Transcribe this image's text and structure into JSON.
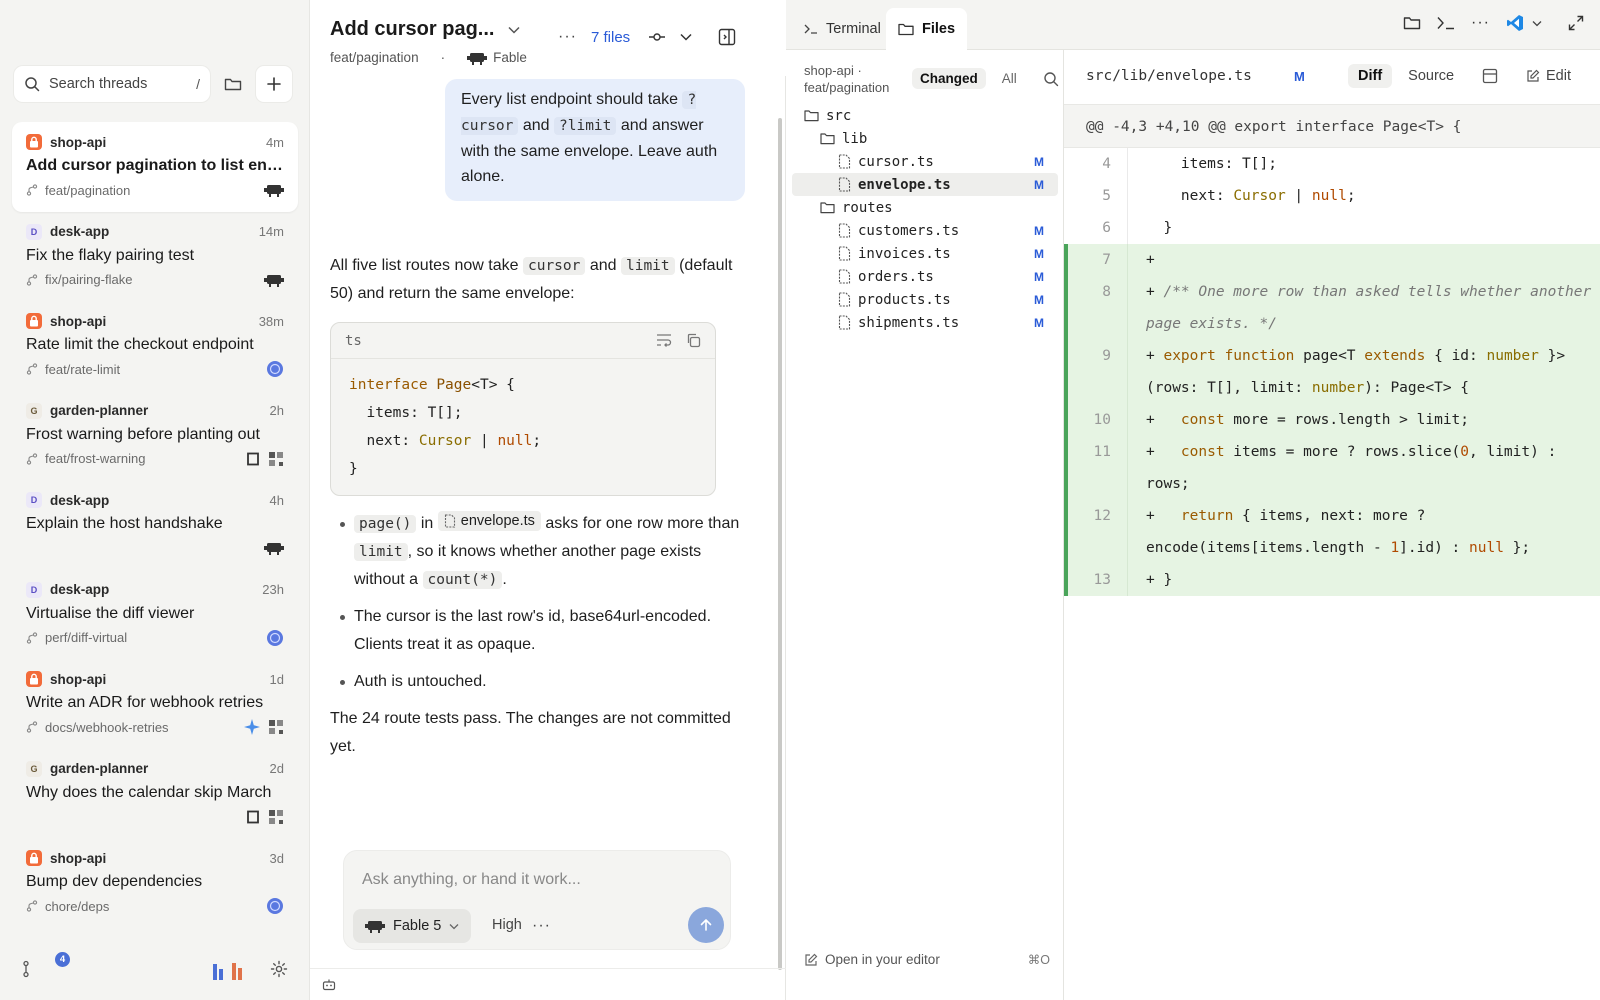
{
  "sidebar": {
    "search_placeholder": "Search threads",
    "search_shortcut": "/",
    "threads": [
      {
        "project": "shop-api",
        "badge": "shop",
        "time": "4m",
        "title": "Add cursor pagination to list end…",
        "branch": "feat/pagination",
        "active": true
      },
      {
        "project": "desk-app",
        "badge": "desk",
        "badge_letter": "D",
        "time": "14m",
        "title": "Fix the flaky pairing test",
        "branch": "fix/pairing-flake"
      },
      {
        "project": "shop-api",
        "badge": "shop",
        "time": "38m",
        "title": "Rate limit the checkout endpoint",
        "branch": "feat/rate-limit"
      },
      {
        "project": "garden-planner",
        "badge": "garden",
        "badge_letter": "G",
        "time": "2h",
        "title": "Frost warning before planting out",
        "branch": "feat/frost-warning"
      },
      {
        "project": "desk-app",
        "badge": "desk",
        "badge_letter": "D",
        "time": "4h",
        "title": "Explain the host handshake",
        "branch": ""
      },
      {
        "project": "desk-app",
        "badge": "desk",
        "badge_letter": "D",
        "time": "23h",
        "title": "Virtualise the diff viewer",
        "branch": "perf/diff-virtual"
      },
      {
        "project": "shop-api",
        "badge": "shop",
        "time": "1d",
        "title": "Write an ADR for webhook retries",
        "branch": "docs/webhook-retries"
      },
      {
        "project": "garden-planner",
        "badge": "garden",
        "badge_letter": "G",
        "time": "2d",
        "title": "Why does the calendar skip March",
        "branch": ""
      },
      {
        "project": "shop-api",
        "badge": "shop",
        "time": "3d",
        "title": "Bump dev dependencies",
        "branch": "chore/deps"
      }
    ],
    "footer_badge_count": "4"
  },
  "chat": {
    "title": "Add cursor pag...",
    "branch": "feat/pagination",
    "separator": "·",
    "model_label": "Fable",
    "files_link": "7 files",
    "user_message": {
      "t1": "Every list endpoint should take",
      "c1": "?cursor",
      "t2": "and",
      "c2": "?limit",
      "t3": "and answer with the same envelope. Leave auth alone."
    },
    "response": {
      "intro_1": "All five list routes now take",
      "intro_c1": "cursor",
      "intro_2": "and",
      "intro_c2": "limit",
      "intro_3": "(default 50) and return the same envelope:",
      "code_lang": "ts",
      "bullet1_c1": "page()",
      "bullet1_t1": "in",
      "bullet1_file": "envelope.ts",
      "bullet1_t2": "asks for one row more than",
      "bullet1_c2": "limit",
      "bullet1_t3": ", so it knows whether another page exists without a",
      "bullet1_c3": "count(*)",
      "bullet1_t4": ".",
      "bullet2": "The cursor is the last row's id, base64url-encoded. Clients treat it as opaque.",
      "bullet3": "Auth is untouched.",
      "closing": "The 24 route tests pass. The changes are not committed yet."
    },
    "composer": {
      "placeholder": "Ask anything, or hand it work...",
      "model": "Fable 5",
      "effort": "High",
      "more": "···"
    }
  },
  "right": {
    "tabs": [
      {
        "label": "Terminal"
      },
      {
        "label": "Files"
      }
    ],
    "file_panel": {
      "project": "shop-api ·",
      "branch": "feat/pagination",
      "tab_changed": "Changed",
      "tab_all": "All",
      "status": "M",
      "tree": {
        "src": "src",
        "lib": "lib",
        "cursor": "cursor.ts",
        "envelope": "envelope.ts",
        "routes": "routes",
        "customers": "customers.ts",
        "invoices": "invoices.ts",
        "orders": "orders.ts",
        "products": "products.ts",
        "shipments": "shipments.ts"
      },
      "open_editor": "Open in your editor",
      "open_shortcut": "⌘O"
    },
    "diff": {
      "path": "src/lib/envelope.ts",
      "status": "M",
      "mode_diff": "Diff",
      "mode_source": "Source",
      "edit": "Edit",
      "hunk": "@@ -4,3 +4,10 @@ export interface Page<T> {",
      "line_numbers": [
        "4",
        "5",
        "6",
        "7",
        "8",
        "9",
        "10",
        "11",
        "12",
        "13"
      ]
    }
  },
  "colors": {
    "accent": "#2a5bd7",
    "added_bg": "#e6f4e3",
    "added_bar": "#4aa45a",
    "shop_badge": "#f26b3a"
  }
}
